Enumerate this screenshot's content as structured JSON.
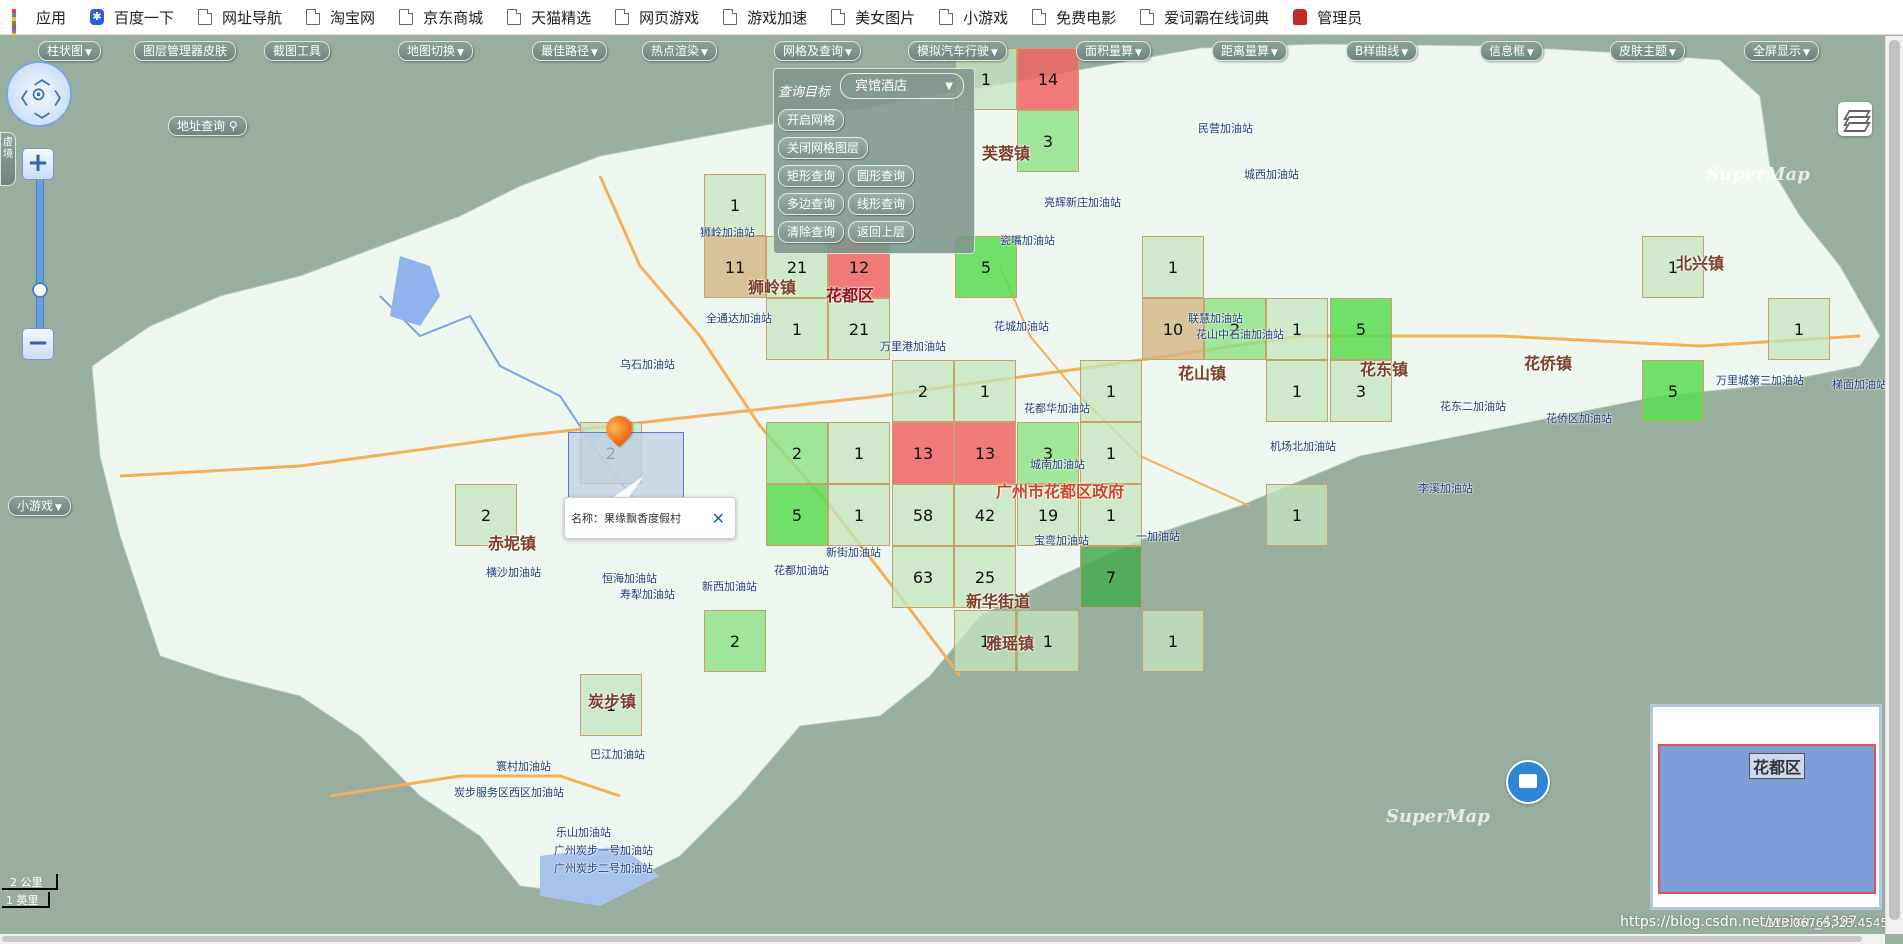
{
  "bookmarks": [
    {
      "label": "应用",
      "icon": "apps-icon"
    },
    {
      "label": "百度一下",
      "icon": "baidu-paw-icon"
    },
    {
      "label": "网址导航",
      "icon": "page-icon"
    },
    {
      "label": "淘宝网",
      "icon": "page-icon"
    },
    {
      "label": "京东商城",
      "icon": "page-icon"
    },
    {
      "label": "天猫精选",
      "icon": "page-icon"
    },
    {
      "label": "网页游戏",
      "icon": "page-icon"
    },
    {
      "label": "游戏加速",
      "icon": "page-icon"
    },
    {
      "label": "美女图片",
      "icon": "page-icon"
    },
    {
      "label": "小游戏",
      "icon": "page-icon"
    },
    {
      "label": "免费电影",
      "icon": "page-icon"
    },
    {
      "label": "爱词霸在线词典",
      "icon": "page-icon"
    },
    {
      "label": "管理员",
      "icon": "admin-car-icon"
    }
  ],
  "toolbar": [
    "柱状图",
    "图层管理器皮肤",
    "截图工具",
    "地图切换",
    "最佳路径",
    "热点渲染",
    "网格及查询",
    "模拟汽车行驶",
    "面积量算",
    "距离量算",
    "B样曲线",
    "信息框",
    "皮肤主题",
    "全屏显示"
  ],
  "side_tags": {
    "address_search": "地址查询",
    "mini_games": "小游戏",
    "left_edge": "虚\n境"
  },
  "query_panel": {
    "label": "查询目标",
    "target": "宾馆酒店",
    "buttons": [
      "开启网格",
      "关闭网格图层",
      "矩形查询",
      "圆形查询",
      "多边查询",
      "线形查询",
      "清除查询",
      "返回上层"
    ]
  },
  "popup": {
    "text": "名称：果缘飘香度假村"
  },
  "grid_counts": [
    "14",
    "1",
    "3",
    "1",
    "11",
    "21",
    "12",
    "5",
    "1",
    "21",
    "1",
    "10",
    "2",
    "1",
    "5",
    "1",
    "1",
    "2",
    "1",
    "1",
    "1",
    "3",
    "5",
    "2",
    "13",
    "13",
    "3",
    "1",
    "2",
    "5",
    "1",
    "58",
    "42",
    "19",
    "1",
    "1",
    "63",
    "25",
    "7",
    "1",
    "1",
    "1",
    "2",
    "1",
    "1",
    "2"
  ],
  "places": [
    "狮岭镇",
    "花都区",
    "芙蓉镇",
    "花山镇",
    "花东镇",
    "花侨镇",
    "北兴镇",
    "赤坭镇",
    "炭步镇",
    "新华街道",
    "雅瑶镇",
    "广州市花都区政府"
  ],
  "pois": [
    "民营加油站",
    "城西加油站",
    "亮辉新庄加油站",
    "瓷嘴加油站",
    "狮岭加油站",
    "全通达加油站",
    "乌石加油站",
    "万里港加油站",
    "花城加油站",
    "花都华加油站",
    "城南加油站",
    "新街加油站",
    "花都加油站",
    "巴江加油站",
    "寰村加油站",
    "炭步服务区西区加油站",
    "乐山加油站",
    "广州炭步一号加油站",
    "广州炭步二号加油站",
    "万里城第三加油站",
    "花侨区加油站",
    "花东二加油站",
    "机场北加油站",
    "李溪加油站",
    "联慧加油站",
    "花山中石油加油站",
    "梯面加油站",
    "横沙加油站",
    "恒海加油站",
    "寿犁加油站",
    "新西加油站",
    "宝弯加油站",
    "一加油站"
  ],
  "overview": {
    "label": "花都区"
  },
  "scale": {
    "km": "2 公里",
    "mi": "1 英里"
  },
  "watermark": "https://blog.csdn.net/weixin_4397...",
  "coords": "113.06765, 23.45459",
  "brand": "SuperMap"
}
